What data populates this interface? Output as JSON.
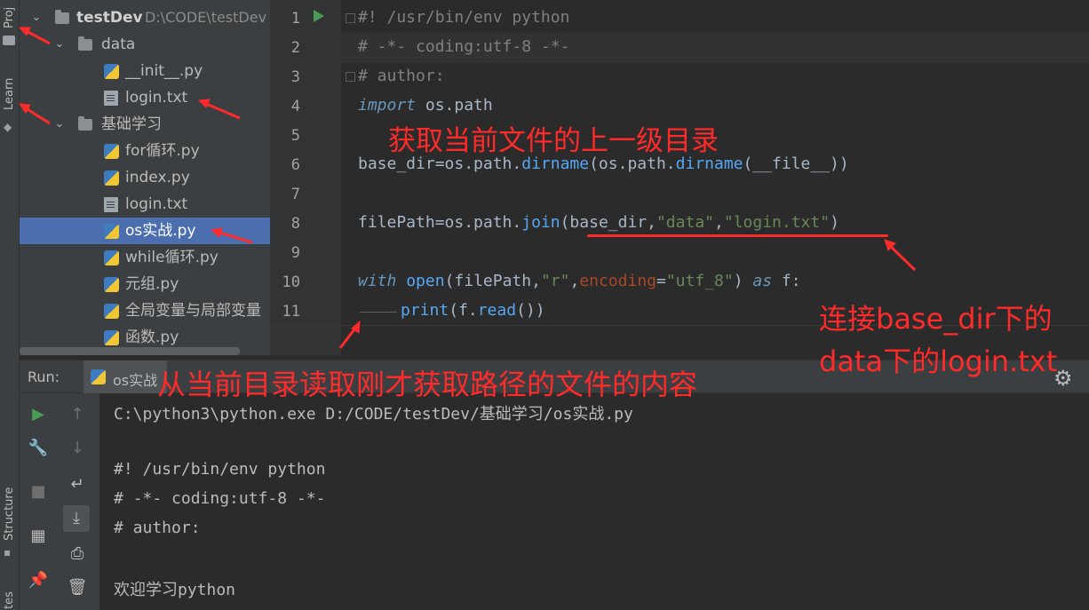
{
  "left_strip": {
    "tabs": [
      "Proj",
      "Learn",
      "Structure",
      "tes"
    ]
  },
  "project": {
    "root": {
      "name": "testDev",
      "path": "D:\\CODE\\testDev"
    },
    "items": [
      {
        "label": "data",
        "kind": "folder",
        "expanded": true
      },
      {
        "label": "__init__.py",
        "kind": "py"
      },
      {
        "label": "login.txt",
        "kind": "file"
      },
      {
        "label": "基础学习",
        "kind": "folder",
        "expanded": true
      },
      {
        "label": "for循环.py",
        "kind": "py"
      },
      {
        "label": "index.py",
        "kind": "py"
      },
      {
        "label": "login.txt",
        "kind": "file"
      },
      {
        "label": "os实战.py",
        "kind": "py",
        "selected": true
      },
      {
        "label": "while循环.py",
        "kind": "py"
      },
      {
        "label": "元组.py",
        "kind": "py"
      },
      {
        "label": "全局变量与局部变量",
        "kind": "py"
      },
      {
        "label": "函数.py",
        "kind": "py"
      }
    ]
  },
  "editor": {
    "line_numbers": [
      "1",
      "2",
      "3",
      "4",
      "5",
      "6",
      "7",
      "8",
      "9",
      "10",
      "11"
    ],
    "lines": {
      "l1": "#! /usr/bin/env python",
      "l2": "# -*- coding:utf-8 -*-",
      "l3": "# author:",
      "l4_kw": "import",
      "l4_rest": " os.path",
      "l6_a": "base_dir=os.path.",
      "l6_fn1": "dirname",
      "l6_b": "(os.path.",
      "l6_fn2": "dirname",
      "l6_c": "(__file__))",
      "l8_a": "filePath=os.path.",
      "l8_fn": "join",
      "l8_b": "(base_dir,",
      "l8_s1": "\"data\"",
      "l8_comma": ",",
      "l8_s2": "\"login.txt\"",
      "l8_c": ")",
      "l10_kw": "with",
      "l10_sp": " ",
      "l10_fn": "open",
      "l10_a": "(filePath,",
      "l10_s1": "\"r\"",
      "l10_b": ",",
      "l10_param": "encoding",
      "l10_eq": "=",
      "l10_s2": "\"utf_8\"",
      "l10_c": ") ",
      "l10_as": "as",
      "l10_d": " f:",
      "l11_fn1": "print",
      "l11_a": "(f.",
      "l11_fn2": "read",
      "l11_b": "())"
    }
  },
  "run": {
    "title": "Run:",
    "tab_label": "os实战",
    "console": [
      "C:\\python3\\python.exe D:/CODE/testDev/基础学习/os实战.py",
      "#! /usr/bin/env python",
      "# -*- coding:utf-8 -*-",
      "# author:",
      "欢迎学习python"
    ]
  },
  "annotations": {
    "a1": "获取当前文件的上一级目录",
    "a2_line1": "连接base_dir下的",
    "a2_line2": "data下的login.txt",
    "a3": "从当前目录读取刚才获取路径的文件的内容"
  },
  "colors": {
    "annotation": "#ff2a2a",
    "selection": "#4b6eaf",
    "keyword": "#cc7832",
    "string": "#6a8759"
  }
}
